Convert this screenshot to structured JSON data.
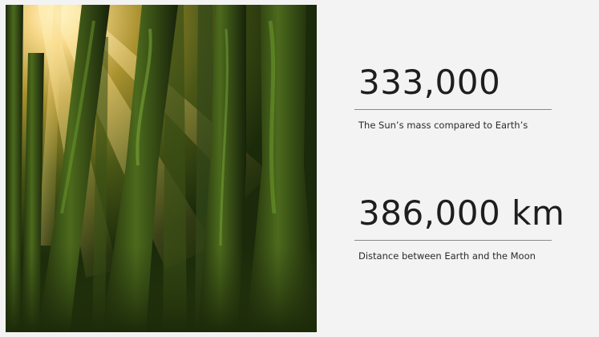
{
  "image": {
    "icon": "forest-sunbeams-photo"
  },
  "stats": [
    {
      "value": "333,000",
      "caption": "The Sun’s mass compared to Earth’s"
    },
    {
      "value": "386,000 km",
      "caption": "Distance between Earth and the Moon"
    }
  ],
  "colors": {
    "background": "#f3f3f3",
    "text": "#1e1e1e",
    "rule": "#8a8a8a"
  }
}
